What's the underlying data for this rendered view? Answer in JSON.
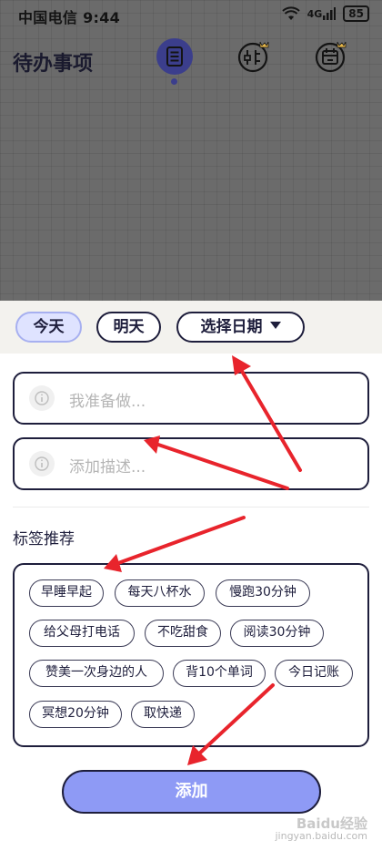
{
  "status_bar": {
    "carrier_time": "中国电信 9:44",
    "signal": "4G",
    "battery": "85"
  },
  "header": {
    "title": "待办事项"
  },
  "nav": [
    {
      "icon": "list-icon",
      "active": true
    },
    {
      "icon": "slider-icon",
      "active": false
    },
    {
      "icon": "calendar-icon",
      "active": false
    }
  ],
  "date_chips": {
    "today": "今天",
    "tomorrow": "明天",
    "select_date": "选择日期"
  },
  "form": {
    "todo_placeholder": "我准备做...",
    "desc_placeholder": "添加描述..."
  },
  "tags": {
    "title": "标签推荐",
    "items": [
      "早睡早起",
      "每天八杯水",
      "慢跑30分钟",
      "给父母打电话",
      "不吃甜食",
      "阅读30分钟",
      "赞美一次身边的人",
      "背10个单词",
      "今日记账",
      "冥想20分钟",
      "取快递"
    ]
  },
  "add_button": "添加",
  "watermark": {
    "logo": "Baidu经验",
    "url": "jingyan.baidu.com"
  },
  "colors": {
    "accent": "#8e9af5",
    "dark": "#1e1e3c",
    "arrow": "#e8242c"
  }
}
